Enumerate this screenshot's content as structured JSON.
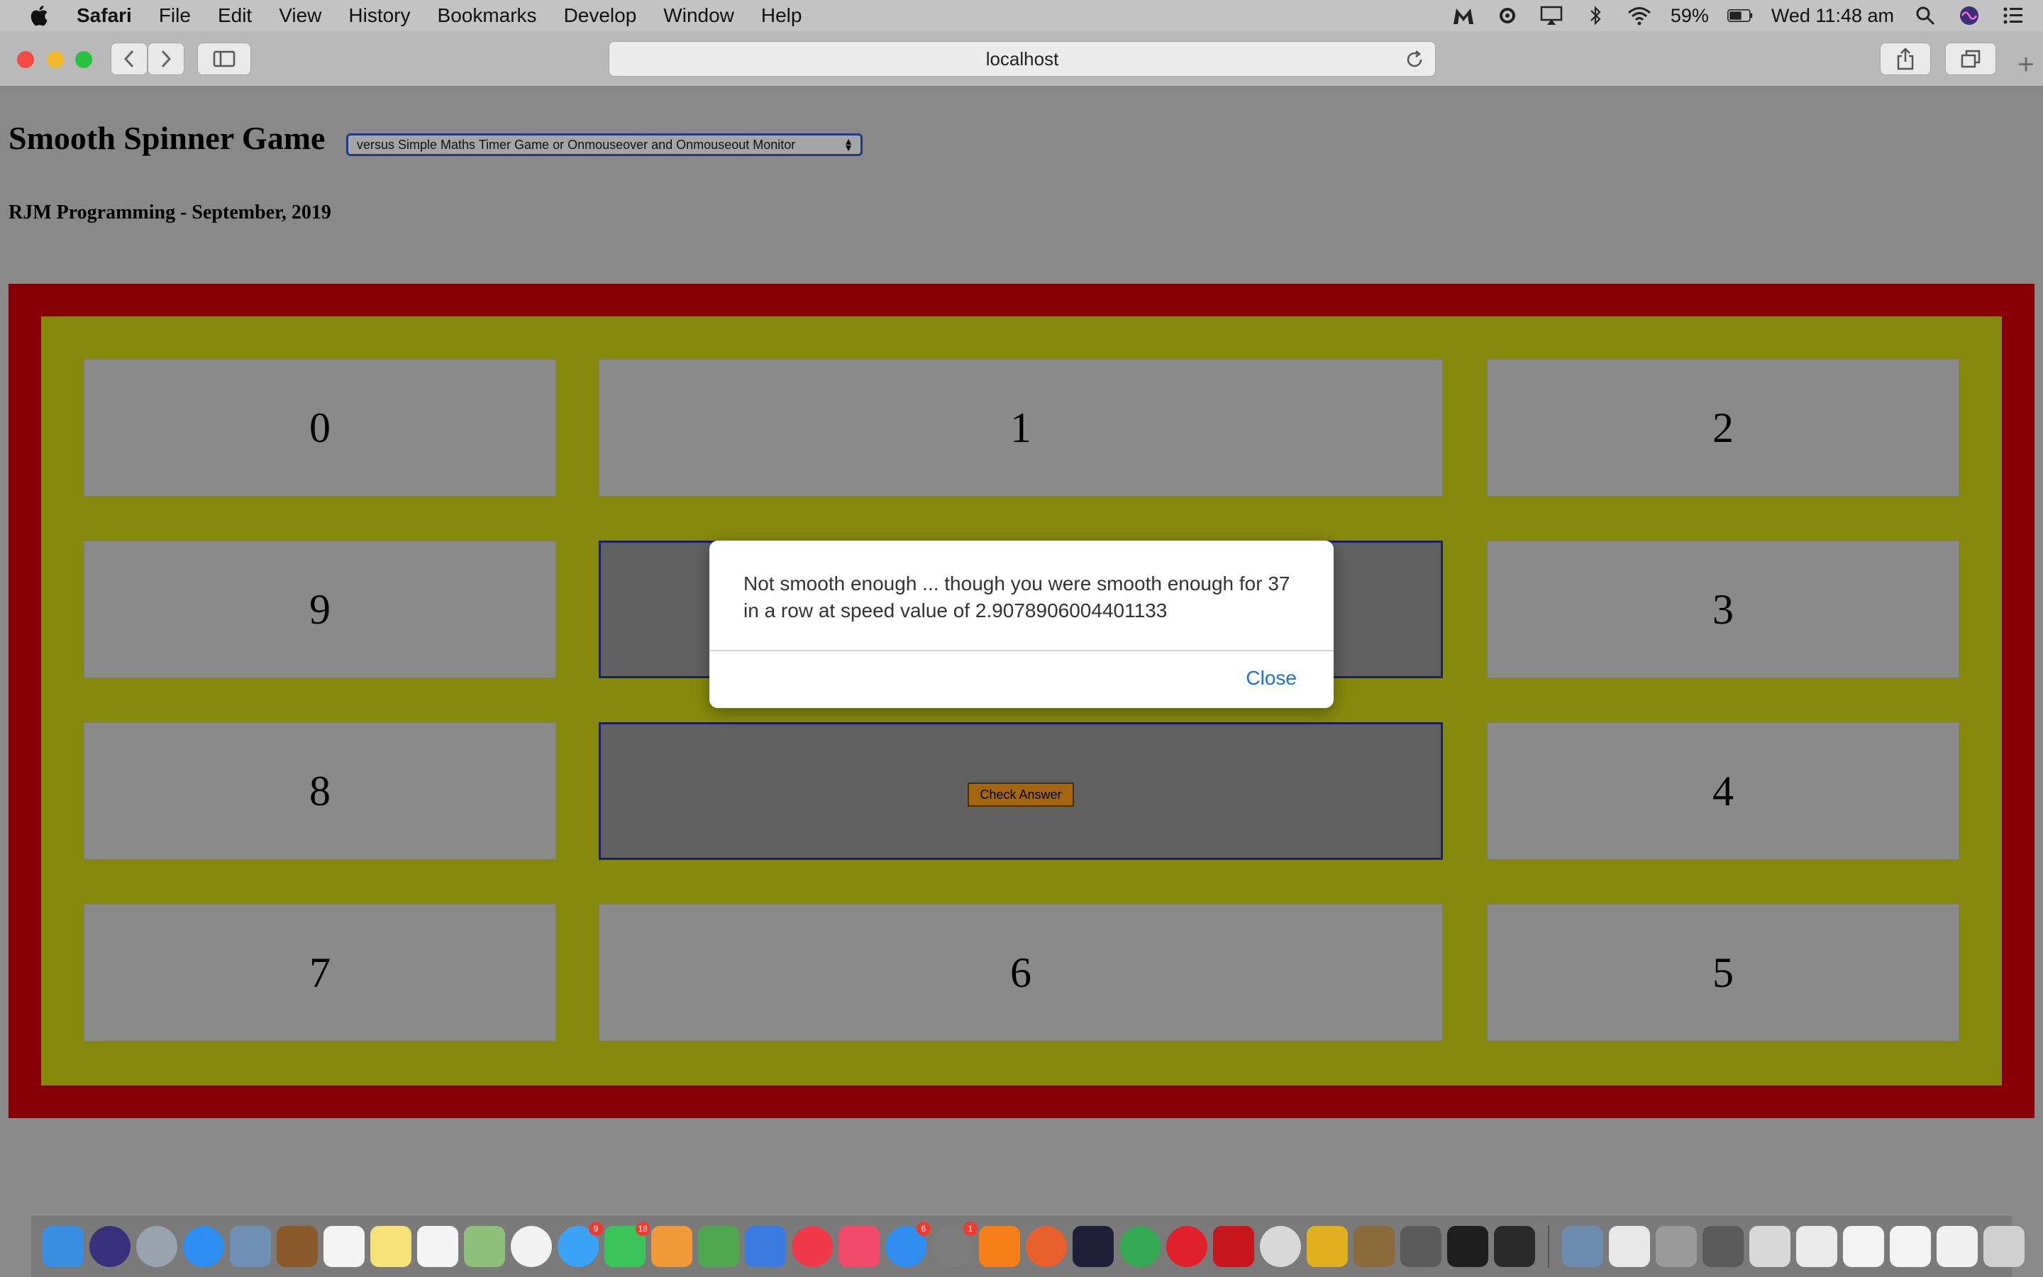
{
  "menubar": {
    "app": "Safari",
    "items": [
      "File",
      "Edit",
      "View",
      "History",
      "Bookmarks",
      "Develop",
      "Window",
      "Help"
    ],
    "battery": "59%",
    "clock": "Wed 11:48 am"
  },
  "toolbar": {
    "address": "localhost"
  },
  "page": {
    "title": "Smooth Spinner Game",
    "select_value": "versus Simple Maths Timer Game or Onmouseover and Onmouseout Monitor",
    "subtitle": "RJM Programming - September, 2019"
  },
  "board": {
    "cells": [
      "0",
      "1",
      "2",
      "9",
      "3",
      "8",
      "4",
      "7",
      "6",
      "5"
    ],
    "check_button": "Check Answer"
  },
  "modal": {
    "message": "Not smooth enough ... though you were smooth enough for 37 in a row at speed value of 2.9078906004401133",
    "close": "Close"
  },
  "dock": {
    "badges": [
      "9",
      "18",
      "6",
      "1"
    ]
  },
  "colors": {
    "board_outer": "#870007",
    "board_inner": "#868a0c",
    "cell": "#8a8a8a",
    "dark_cell": "#616161",
    "check_button": "#a4660f",
    "modal_link": "#1f6fd6"
  }
}
